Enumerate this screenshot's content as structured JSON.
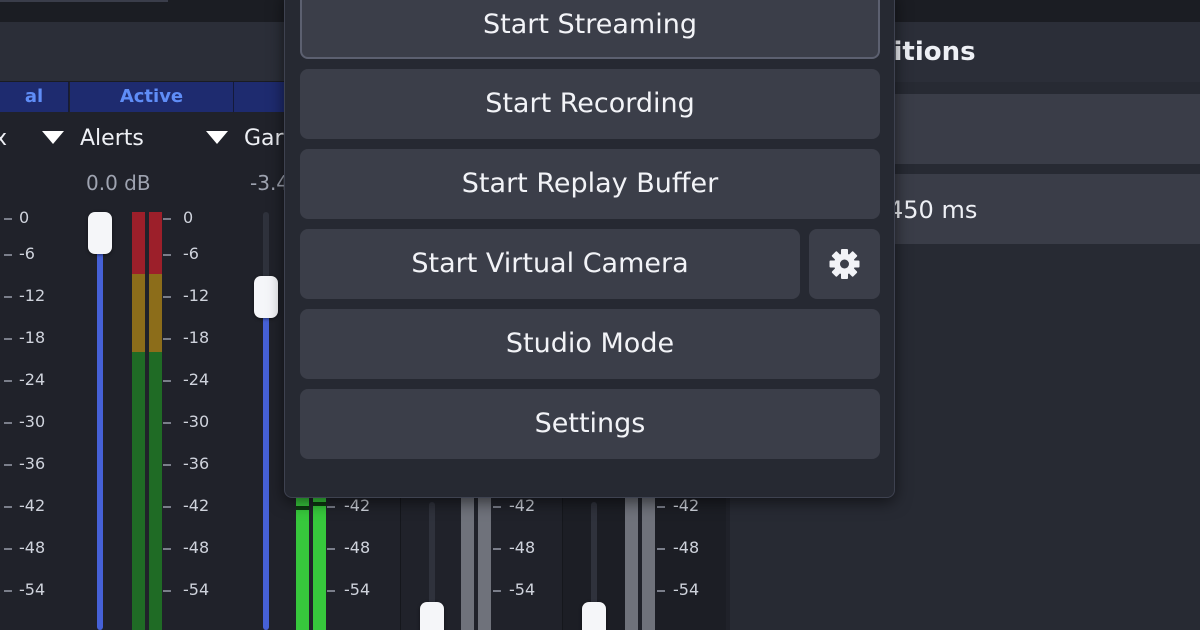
{
  "channels": [
    {
      "status": "al",
      "name": "x",
      "db": ""
    },
    {
      "status": "Active",
      "name": "Alerts",
      "db": "0.0 dB"
    },
    {
      "status": "",
      "name": "Gar",
      "db": "-3.4"
    }
  ],
  "scale": [
    "0",
    "-6",
    "-12",
    "-18",
    "-24",
    "-30",
    "-36",
    "-42",
    "-48",
    "-54"
  ],
  "partial_scale": [
    "-42",
    "-48",
    "-54"
  ],
  "right_panel": {
    "title": "sitions",
    "delay": "450 ms"
  },
  "controls": {
    "start_streaming": "Start Streaming",
    "start_recording": "Start Recording",
    "start_replay_buffer": "Start Replay Buffer",
    "start_virtual_camera": "Start Virtual Camera",
    "virtual_camera_settings_icon": "gear-icon",
    "studio_mode": "Studio Mode",
    "settings": "Settings"
  },
  "colors": {
    "accent": "#4661d6",
    "status_bg": "#1e2b6f",
    "status_text": "#5f8df7",
    "meter_red": "#9c1f2a",
    "meter_yellow": "#8c6d1a",
    "meter_green": "#1f6b25",
    "meter_active": "#37c83c"
  }
}
